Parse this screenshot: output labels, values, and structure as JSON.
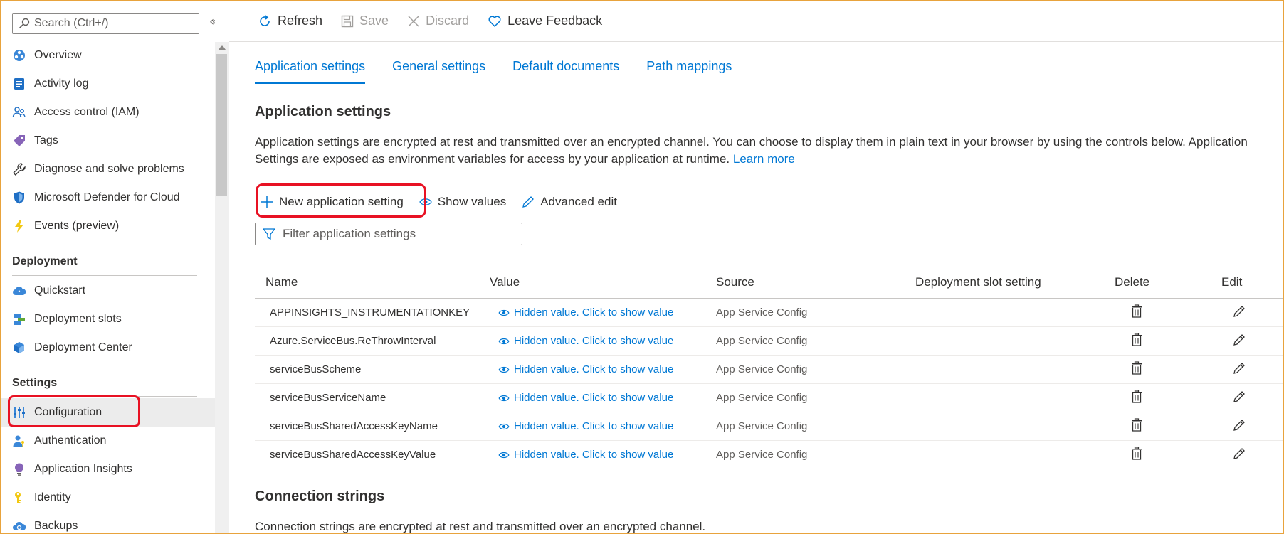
{
  "sidebar": {
    "search_placeholder": "Search (Ctrl+/)",
    "collapse_glyph": "«",
    "top_items": [
      {
        "label": "Overview",
        "icon": "overview-icon"
      },
      {
        "label": "Activity log",
        "icon": "activity-log-icon"
      },
      {
        "label": "Access control (IAM)",
        "icon": "people-icon"
      },
      {
        "label": "Tags",
        "icon": "tag-icon"
      },
      {
        "label": "Diagnose and solve problems",
        "icon": "wrench-icon"
      },
      {
        "label": "Microsoft Defender for Cloud",
        "icon": "shield-icon"
      },
      {
        "label": "Events (preview)",
        "icon": "lightning-icon"
      }
    ],
    "deployment_title": "Deployment",
    "deployment_items": [
      {
        "label": "Quickstart",
        "icon": "cloud-icon"
      },
      {
        "label": "Deployment slots",
        "icon": "slots-icon"
      },
      {
        "label": "Deployment Center",
        "icon": "cube-icon"
      }
    ],
    "settings_title": "Settings",
    "settings_items": [
      {
        "label": "Configuration",
        "icon": "configuration-icon",
        "active": true
      },
      {
        "label": "Authentication",
        "icon": "user-key-icon"
      },
      {
        "label": "Application Insights",
        "icon": "bulb-icon"
      },
      {
        "label": "Identity",
        "icon": "key-icon"
      },
      {
        "label": "Backups",
        "icon": "backup-cloud-icon"
      }
    ]
  },
  "toolbar": {
    "refresh": "Refresh",
    "save": "Save",
    "discard": "Discard",
    "feedback": "Leave Feedback"
  },
  "tabs": [
    {
      "label": "Application settings",
      "active": true
    },
    {
      "label": "General settings"
    },
    {
      "label": "Default documents"
    },
    {
      "label": "Path mappings"
    }
  ],
  "app_settings": {
    "title": "Application settings",
    "description": "Application settings are encrypted at rest and transmitted over an encrypted channel. You can choose to display them in plain text in your browser by using the controls below. Application Settings are exposed as environment variables for access by your application at runtime.",
    "learn_more": "Learn more",
    "new_setting": "New application setting",
    "show_values": "Show values",
    "advanced_edit": "Advanced edit",
    "filter_placeholder": "Filter application settings"
  },
  "table": {
    "headers": {
      "name": "Name",
      "value": "Value",
      "source": "Source",
      "slot": "Deployment slot setting",
      "delete": "Delete",
      "edit": "Edit"
    },
    "rows": [
      {
        "name": "APPINSIGHTS_INSTRUMENTATIONKEY",
        "value": "Hidden value. Click to show value",
        "source": "App Service Config"
      },
      {
        "name": "Azure.ServiceBus.ReThrowInterval",
        "value": "Hidden value. Click to show value",
        "source": "App Service Config"
      },
      {
        "name": "serviceBusScheme",
        "value": "Hidden value. Click to show value",
        "source": "App Service Config"
      },
      {
        "name": "serviceBusServiceName",
        "value": "Hidden value. Click to show value",
        "source": "App Service Config"
      },
      {
        "name": "serviceBusSharedAccessKeyName",
        "value": "Hidden value. Click to show value",
        "source": "App Service Config"
      },
      {
        "name": "serviceBusSharedAccessKeyValue",
        "value": "Hidden value. Click to show value",
        "source": "App Service Config"
      }
    ]
  },
  "connection_strings": {
    "title": "Connection strings",
    "description": "Connection strings are encrypted at rest and transmitted over an encrypted channel."
  },
  "colors": {
    "accent": "#0078d4",
    "highlight": "#e81123",
    "frame": "#e8a33d"
  }
}
